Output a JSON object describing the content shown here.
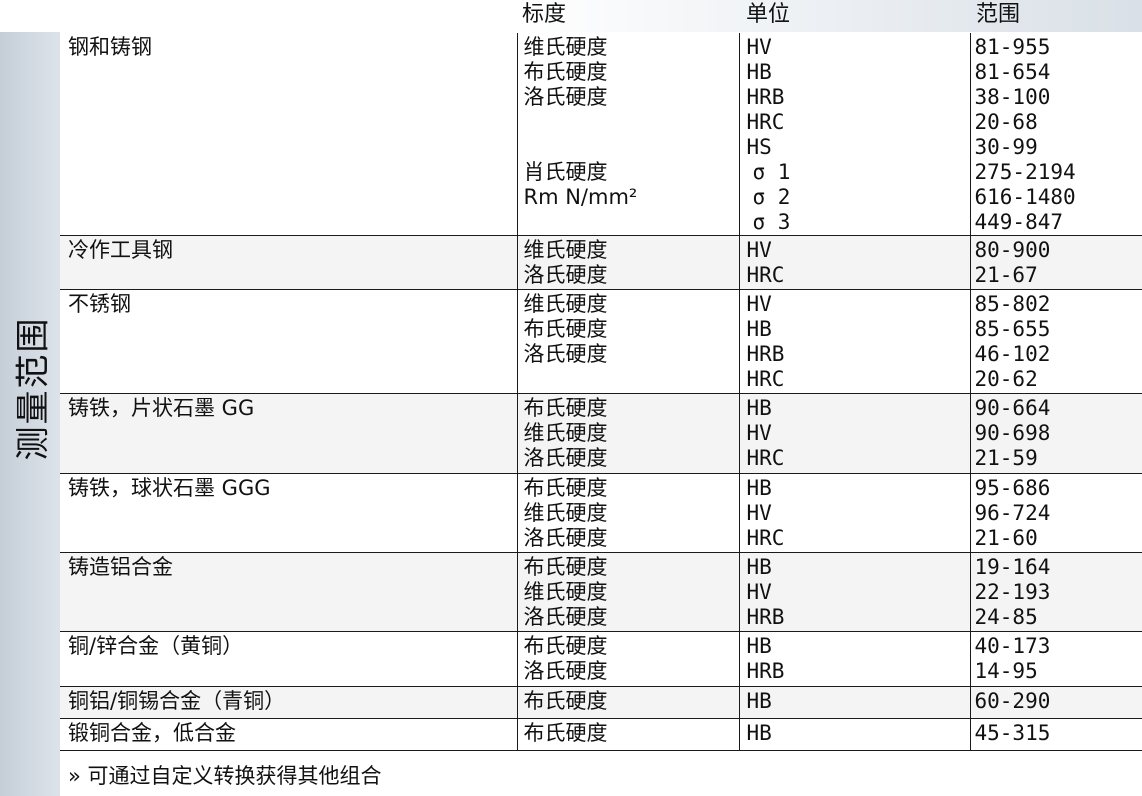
{
  "sidebar": {
    "label": "测量范围"
  },
  "header": {
    "scale": "标度",
    "unit": "单位",
    "range": "范围"
  },
  "rows": [
    {
      "material": "钢和铸钢",
      "scales": [
        "维氏硬度",
        "布氏硬度",
        "洛氏硬度",
        "",
        "",
        "肖氏硬度",
        "Rm N/mm²",
        ""
      ],
      "units": [
        "HV",
        "HB",
        "HRB",
        "HRC",
        "HS",
        "σ 1",
        "σ 2",
        "σ 3"
      ],
      "ranges": [
        "81-955",
        "81-654",
        "38-100",
        "20-68",
        "30-99",
        "275-2194",
        "616-1480",
        "449-847"
      ]
    },
    {
      "material": "冷作工具钢",
      "scales": [
        "维氏硬度",
        "洛氏硬度"
      ],
      "units": [
        "HV",
        "HRC"
      ],
      "ranges": [
        "80-900",
        "21-67"
      ]
    },
    {
      "material": "不锈钢",
      "scales": [
        "维氏硬度",
        "布氏硬度",
        "洛氏硬度",
        ""
      ],
      "units": [
        "HV",
        "HB",
        "HRB",
        "HRC"
      ],
      "ranges": [
        "85-802",
        "85-655",
        "46-102",
        "20-62"
      ]
    },
    {
      "material": "铸铁，片状石墨 GG",
      "scales": [
        "布氏硬度",
        "维氏硬度",
        "洛氏硬度"
      ],
      "units": [
        "HB",
        "HV",
        "HRC"
      ],
      "ranges": [
        "90-664",
        "90-698",
        "21-59"
      ]
    },
    {
      "material": "铸铁，球状石墨 GGG",
      "scales": [
        "布氏硬度",
        "维氏硬度",
        "洛氏硬度"
      ],
      "units": [
        "HB",
        "HV",
        "HRC"
      ],
      "ranges": [
        "95-686",
        "96-724",
        "21-60"
      ]
    },
    {
      "material": "铸造铝合金",
      "scales": [
        "布氏硬度",
        "维氏硬度",
        "洛氏硬度"
      ],
      "units": [
        "HB",
        "HV",
        "HRB"
      ],
      "ranges": [
        "19-164",
        "22-193",
        "24-85"
      ]
    },
    {
      "material": "铜/锌合金（黄铜）",
      "scales": [
        "布氏硬度",
        "洛氏硬度"
      ],
      "units": [
        "HB",
        "HRB"
      ],
      "ranges": [
        "40-173",
        "14-95"
      ]
    },
    {
      "material": "铜铝/铜锡合金（青铜）",
      "scales": [
        "布氏硬度"
      ],
      "units": [
        "HB"
      ],
      "ranges": [
        "60-290"
      ]
    },
    {
      "material": "锻铜合金，低合金",
      "scales": [
        "布氏硬度"
      ],
      "units": [
        "HB"
      ],
      "ranges": [
        "45-315"
      ]
    }
  ],
  "footnote": "» 可通过自定义转换获得其他组合"
}
